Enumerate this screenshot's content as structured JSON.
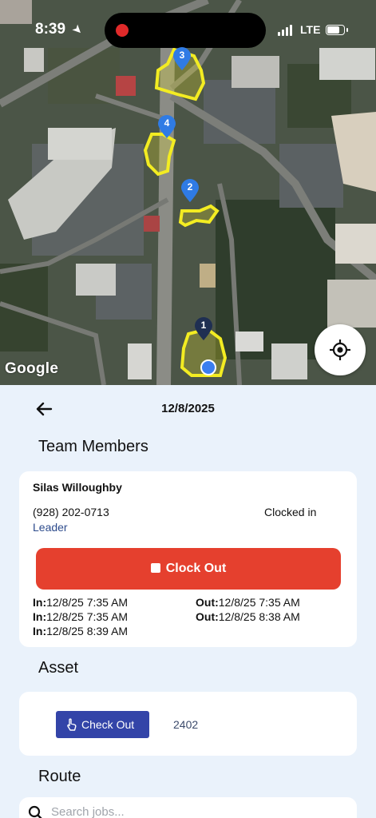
{
  "status_bar": {
    "time": "8:39",
    "network": "LTE",
    "battery_level": 0.8
  },
  "map": {
    "attribution": "Google",
    "pins": [
      {
        "label": "3",
        "color": "#2f7be5"
      },
      {
        "label": "4",
        "color": "#2f7be5"
      },
      {
        "label": "2",
        "color": "#2f7be5"
      },
      {
        "label": "1",
        "color": "#1f2f52"
      }
    ],
    "zone_color": "#f3ec22"
  },
  "header": {
    "date": "12/8/2025"
  },
  "team_members": {
    "title": "Team Members",
    "member": {
      "name": "Silas Willoughby",
      "phone": "(928) 202-0713",
      "status": "Clocked in",
      "role": "Leader"
    },
    "clock_button_label": "Clock Out",
    "entries": [
      {
        "label": "In:",
        "value": "12/8/25 7:35 AM"
      },
      {
        "label": "Out:",
        "value": "12/8/25 7:35 AM"
      },
      {
        "label": "In:",
        "value": "12/8/25 7:35 AM"
      },
      {
        "label": "Out:",
        "value": "12/8/25 8:38 AM"
      },
      {
        "label": "In:",
        "value": "12/8/25 8:39 AM"
      }
    ]
  },
  "asset": {
    "title": "Asset",
    "checkout_label": "Check Out",
    "asset_id": "2402"
  },
  "route": {
    "title": "Route",
    "search_placeholder": "Search jobs..."
  },
  "colors": {
    "accent_red": "#e5402e",
    "accent_blue": "#3344a8",
    "background": "#eaf2fb"
  }
}
